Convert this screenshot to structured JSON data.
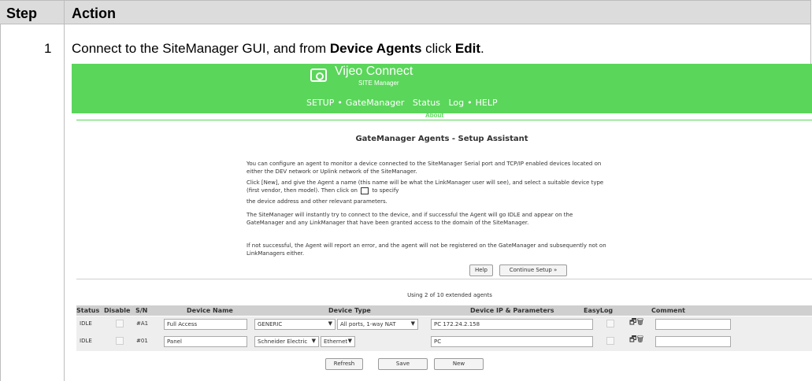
{
  "header": {
    "step_label": "Step",
    "action_label": "Action"
  },
  "row1": {
    "step": "1",
    "instr_pre": "Connect to the SiteManager GUI, and from ",
    "instr_bold1": "Device Agents",
    "instr_mid": " click ",
    "instr_bold2": "Edit",
    "instr_post": "."
  },
  "app": {
    "brand": "Vijeo Connect",
    "brand_sub": "SITE Manager",
    "nav": [
      "SETUP",
      "GateManager",
      "Status",
      "Log",
      "HELP"
    ],
    "nav_dot": "•",
    "about": "About",
    "title": "GateManager Agents - Setup Assistant",
    "p1": "You can configure an agent to monitor a device connected to the SiteManager Serial port and TCP/IP enabled devices located on either the DEV network or Uplink network of the SiteManager.",
    "p2a": "Click [New], and give the Agent a name (this name will be what the LinkManager user will see), and select a suitable device type (first vendor, then model). Then click on",
    "p2b": "to specify",
    "p3": "the device address and other relevant parameters.",
    "p4": "The SiteManager will instantly try to connect to the device, and if successful the Agent will go IDLE and appear on the GateManager and any LinkManager that have been granted access to the domain of the SiteManager.",
    "p5": "If not successful, the Agent will report an error, and the agent will not be registered on the GateManager and subsequently not on LinkManagers either.",
    "help_btn": "Help",
    "continue_btn": "Continue Setup »",
    "usage": "Using 2 of 10 extended agents",
    "columns": [
      "Status",
      "Disable",
      "S/N",
      "Device Name",
      "Device Type",
      "Device IP & Parameters",
      "EasyLog",
      "Comment"
    ],
    "rows": [
      {
        "status": "IDLE",
        "sn": "#A1",
        "name": "Full Access",
        "vendor": "GENERIC",
        "model": "All ports, 1-way NAT",
        "ip": "PC 172.24.2.158",
        "comment": ""
      },
      {
        "status": "IDLE",
        "sn": "#01",
        "name": "Panel",
        "vendor": "Schneider Electric",
        "model": "Ethernet",
        "ip": "PC",
        "comment": ""
      }
    ],
    "row_icons": "🗗🗑",
    "refresh_btn": "Refresh",
    "save_btn": "Save",
    "new_btn": "New"
  }
}
